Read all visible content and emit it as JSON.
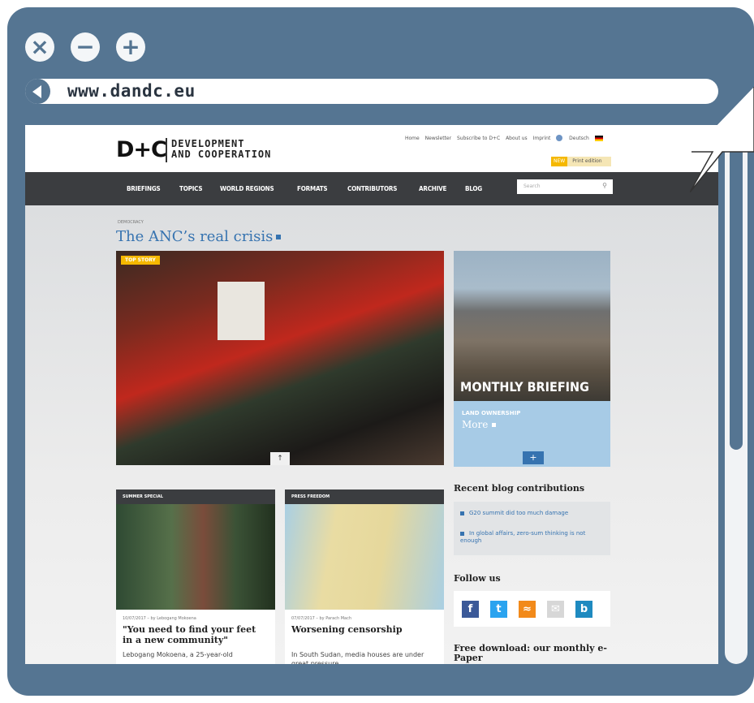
{
  "browser": {
    "url": "www.dandc.eu",
    "controls": {
      "close": "×",
      "minimize": "−",
      "maximize": "+"
    }
  },
  "site": {
    "logo": "D+C",
    "tagline_line1": "DEVELOPMENT",
    "tagline_line2": "AND COOPERATION",
    "top_links": [
      "Home",
      "Newsletter",
      "Subscribe to D+C",
      "About us",
      "Imprint"
    ],
    "language": "Deutsch",
    "print_tag": "NEW",
    "print_label": "Print edition",
    "nav": [
      "BRIEFINGS",
      "TOPICS",
      "WORLD REGIONS",
      "FORMATS",
      "CONTRIBUTORS",
      "ARCHIVE",
      "BLOG"
    ],
    "search_placeholder": "Search",
    "search_icon": "search-icon"
  },
  "main": {
    "kicker": "DEMOCRACY",
    "headline": "The ANC’s real crisis",
    "hero_badge": "TOP STORY",
    "hero_up": "↑",
    "briefing_title": "MONTHLY BRIEFING",
    "briefing_topic": "LAND OWNERSHIP",
    "briefing_more": "More",
    "briefing_plus": "+"
  },
  "cards": [
    {
      "label": "SUMMER SPECIAL",
      "meta": "10/07/2017 – by Lebogang Mokoena",
      "title": "\"You need to find your feet in a new community\"",
      "excerpt": "Lebogang Mokoena, a 25-year-old"
    },
    {
      "label": "PRESS FREEDOM",
      "meta": "07/07/2017 – by Parach Mach",
      "title": "Worsening censorship",
      "excerpt": "In South Sudan, media houses are under great pressure"
    }
  ],
  "sidebar": {
    "blog_heading": "Recent blog contributions",
    "blog_items": [
      "G20 summit did too much damage",
      "In global affairs, zero-sum thinking is not enough"
    ],
    "follow_heading": "Follow us",
    "social": [
      {
        "name": "facebook-icon",
        "glyph": "f",
        "color": "#3b5998"
      },
      {
        "name": "twitter-icon",
        "glyph": "t",
        "color": "#2aa3ef"
      },
      {
        "name": "rss-icon",
        "glyph": "≈",
        "color": "#f28a1a"
      },
      {
        "name": "mail-icon",
        "glyph": "✉",
        "color": "#d7d7d7"
      },
      {
        "name": "chat-icon",
        "glyph": "b",
        "color": "#1e8ac0"
      }
    ],
    "download_heading": "Free download: our monthly e-Paper"
  }
}
